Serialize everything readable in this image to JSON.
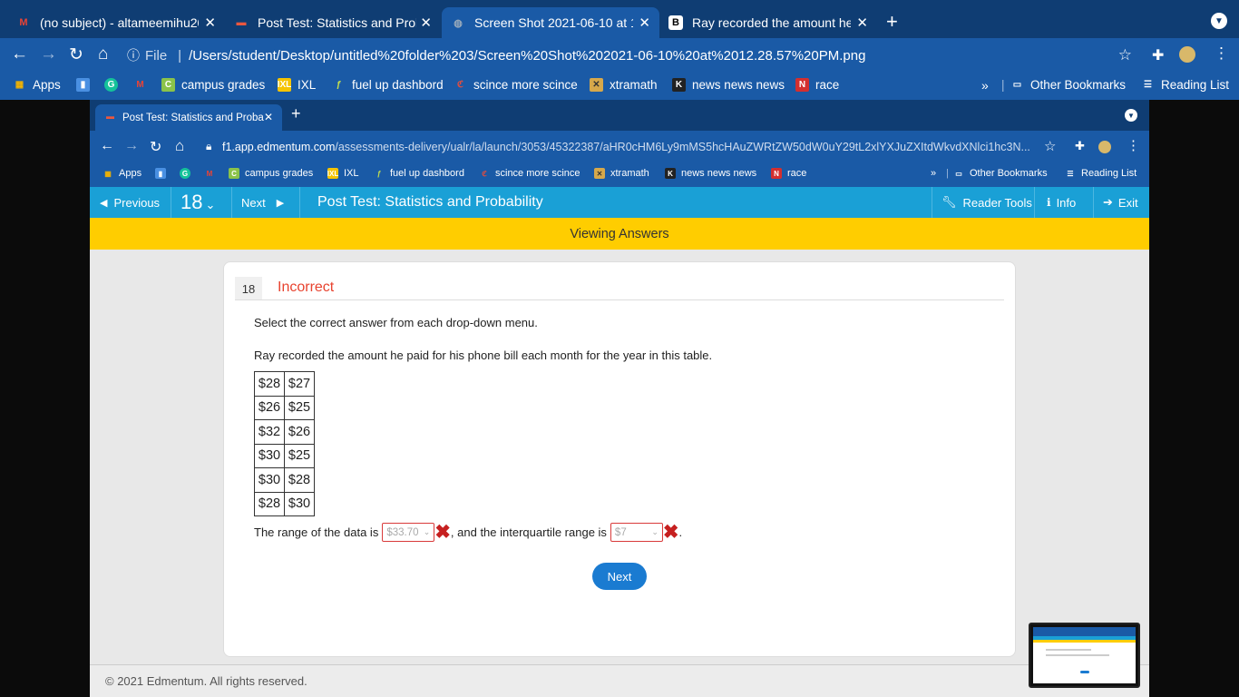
{
  "outer_browser": {
    "tabs": [
      {
        "title": "(no subject) - altameemihu202",
        "icon": "gmail-icon"
      },
      {
        "title": "Post Test: Statistics and Proba",
        "icon": "edmentum-icon"
      },
      {
        "title": "Screen Shot 2021-06-10 at 12.",
        "icon": "globe-icon"
      },
      {
        "title": "Ray recorded the amount he pa",
        "icon": "brainly-icon"
      }
    ],
    "url_prefix": "File",
    "url": "/Users/student/Desktop/untitled%20folder%203/Screen%20Shot%202021-06-10%20at%2012.28.57%20PM.png",
    "bookmarks": [
      "Apps",
      "campus grades",
      "IXL",
      "fuel up dashbord",
      "scince more scince",
      "xtramath",
      "news news news",
      "race"
    ],
    "other_bookmarks": "Other Bookmarks",
    "reading_list": "Reading List",
    "overflow": "»"
  },
  "inner_browser": {
    "tab_title": "Post Test: Statistics and Proba",
    "url_domain": "f1.app.edmentum.com",
    "url_path": "/assessments-delivery/ualr/la/launch/3053/45322387/aHR0cHM6Ly9mMS5hcHAuZWRtZW50dW0uY29tL2xlYXJuZXItdWkvdXNlci1hc3N...",
    "bookmarks": [
      "Apps",
      "campus grades",
      "IXL",
      "fuel up dashbord",
      "scince more scince",
      "xtramath",
      "news news news",
      "race"
    ],
    "other_bookmarks": "Other Bookmarks",
    "reading_list": "Reading List",
    "overflow": "»"
  },
  "toolbar": {
    "previous": "Previous",
    "question_number": "18",
    "next": "Next",
    "title": "Post Test: Statistics and Probability",
    "reader_tools": "Reader Tools",
    "info": "Info",
    "exit": "Exit"
  },
  "banner": "Viewing Answers",
  "question": {
    "number": "18",
    "status": "Incorrect",
    "instruction": "Select the correct answer from each drop-down menu.",
    "prompt": "Ray recorded the amount he paid for his phone bill each month for the year in this table.",
    "table": [
      [
        "$28",
        "$27"
      ],
      [
        "$26",
        "$25"
      ],
      [
        "$32",
        "$26"
      ],
      [
        "$30",
        "$25"
      ],
      [
        "$30",
        "$28"
      ],
      [
        "$28",
        "$30"
      ]
    ],
    "sentence_part1": "The range of the data is",
    "answer1": "$33.70",
    "sentence_part2": ", and the interquartile range is",
    "answer2": "$7",
    "sentence_end": ".",
    "next_button": "Next"
  },
  "footer": "© 2021 Edmentum. All rights reserved.",
  "colors": {
    "outer_tab_bar": "#0f3d73",
    "chrome": "#1a5aa6",
    "app_bar": "#1aa0d6",
    "banner": "#ffcd00",
    "incorrect": "#e8432f",
    "next_button": "#1a7bd1"
  }
}
